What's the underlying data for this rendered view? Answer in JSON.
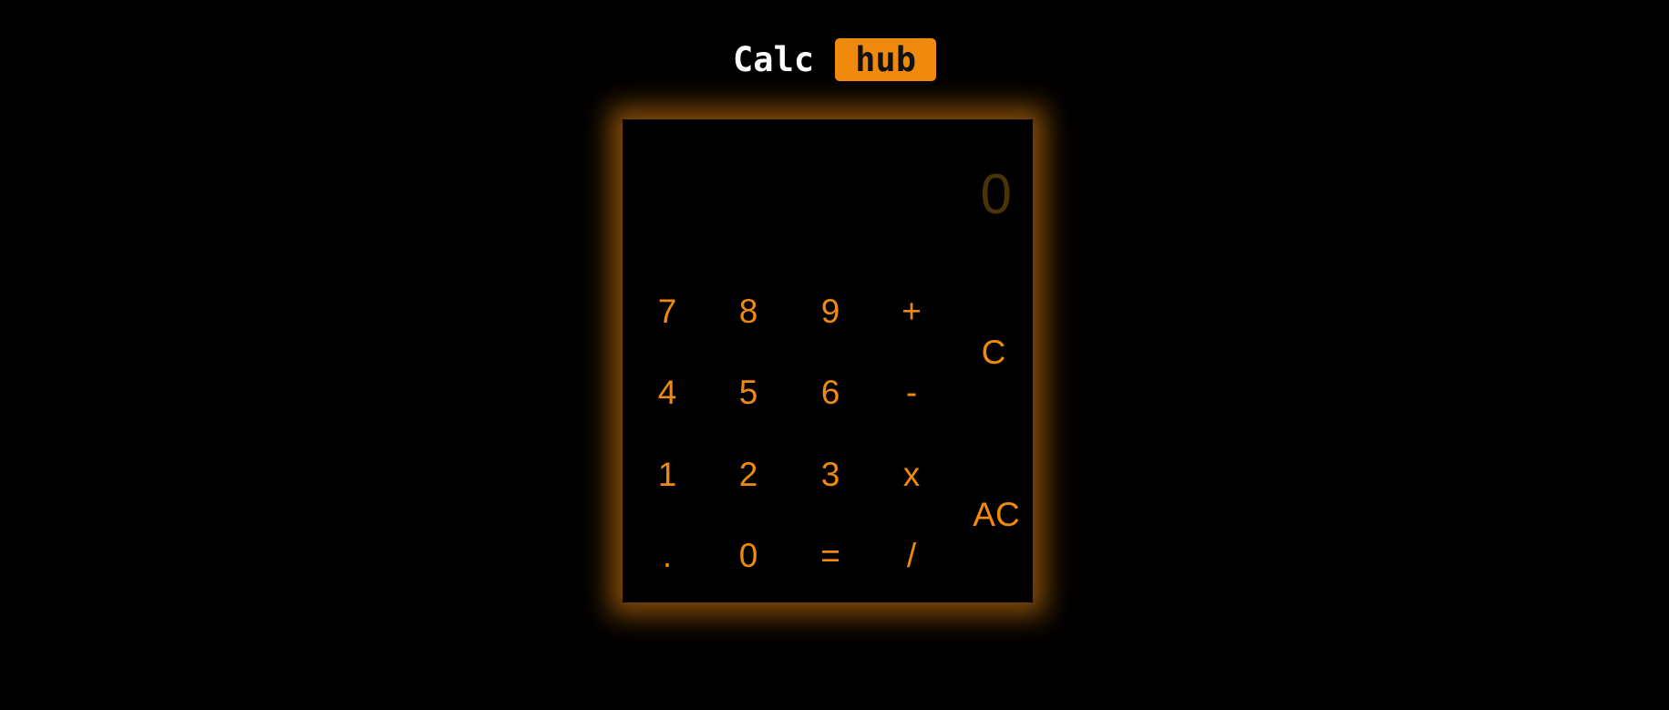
{
  "header": {
    "logo_part1": "Calc",
    "logo_part2": "hub"
  },
  "display": {
    "value": "0"
  },
  "keys": {
    "k7": "7",
    "k8": "8",
    "k9": "9",
    "plus": "+",
    "clear": "C",
    "k4": "4",
    "k5": "5",
    "k6": "6",
    "minus": "-",
    "k1": "1",
    "k2": "2",
    "k3": "3",
    "multiply": "x",
    "all_clear": "AC",
    "decimal": ".",
    "k0": "0",
    "equals": "=",
    "divide": "/"
  },
  "colors": {
    "accent": "#f08a0f",
    "background": "#000000",
    "display_text": "#4a3307",
    "logo_text": "#ffffff"
  }
}
